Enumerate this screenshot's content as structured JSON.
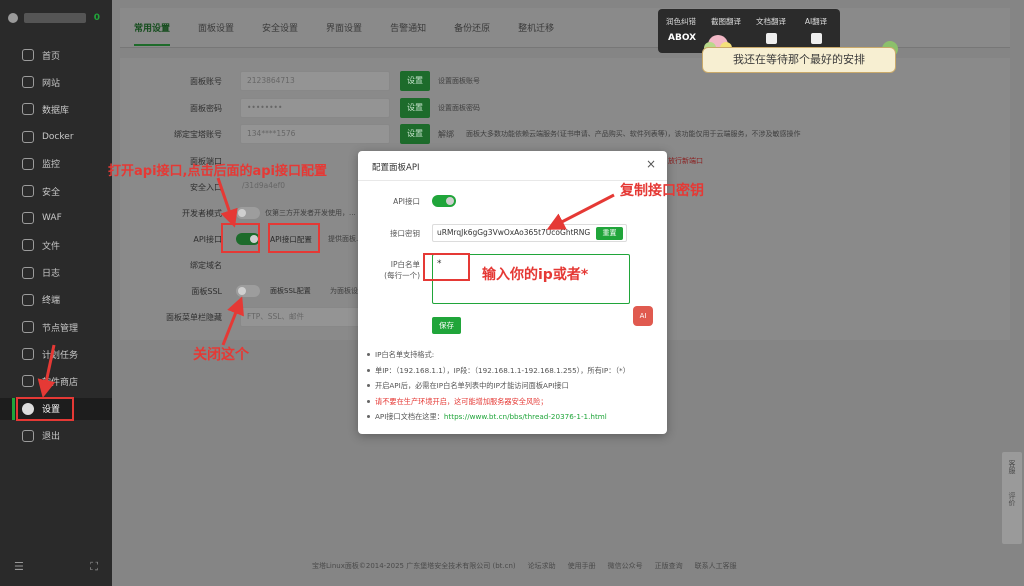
{
  "sidebar": {
    "badge": "0",
    "items": [
      {
        "label": "首页",
        "icon": "home-icon"
      },
      {
        "label": "网站",
        "icon": "globe-icon"
      },
      {
        "label": "数据库",
        "icon": "database-icon"
      },
      {
        "label": "Docker",
        "icon": "docker-icon"
      },
      {
        "label": "监控",
        "icon": "monitor-icon"
      },
      {
        "label": "安全",
        "icon": "shield-icon"
      },
      {
        "label": "WAF",
        "icon": "waf-icon"
      },
      {
        "label": "文件",
        "icon": "folder-icon"
      },
      {
        "label": "日志",
        "icon": "log-icon"
      },
      {
        "label": "终端",
        "icon": "terminal-icon"
      },
      {
        "label": "节点管理",
        "icon": "node-icon"
      },
      {
        "label": "计划任务",
        "icon": "clock-icon"
      },
      {
        "label": "软件商店",
        "icon": "store-icon"
      },
      {
        "label": "设置",
        "icon": "gear-icon",
        "active": true
      },
      {
        "label": "退出",
        "icon": "logout-icon"
      }
    ],
    "foot_left": "☰",
    "foot_right": "⛶"
  },
  "tabs": [
    "常用设置",
    "面板设置",
    "安全设置",
    "界面设置",
    "告警通知",
    "备份还原",
    "整机迁移"
  ],
  "settings": {
    "account": {
      "label": "面板账号",
      "value": "2123864713",
      "btn": "设置",
      "hint": "设置面板账号"
    },
    "password": {
      "label": "面板密码",
      "value": "••••••••",
      "btn": "设置",
      "hint": "设置面板密码"
    },
    "bind": {
      "label": "绑定宝塔账号",
      "value": "134****1576",
      "btn": "设置",
      "btn2": "解绑",
      "hint": "面板大多数功能依赖云端服务(证书申请、产品购买、软件列表等)，该功能仅用于云端服务，不涉及敏感操作"
    },
    "port": {
      "label": "面板端口"
    },
    "port_hint": "放行新端口",
    "entry": {
      "label": "安全入口",
      "value": "/31d9a4ef0"
    },
    "dev": {
      "label": "开发者模式",
      "hint": "仅第三方开发者开发使用，..."
    },
    "api": {
      "label": "API接口",
      "btn": "API接口配置",
      "hint": "提供面板..."
    },
    "domain": {
      "label": "绑定域名"
    },
    "ssl": {
      "label": "面板SSL",
      "btn": "面板SSL配置",
      "hint": "为面板设..."
    },
    "menu": {
      "label": "面板菜单栏隐藏",
      "value": "FTP、SSL、邮件"
    }
  },
  "footer": {
    "copyright": "宝塔Linux面板©2014-2025 广东堡塔安全技术有限公司 (bt.cn)",
    "links": [
      "论坛求助",
      "使用手册",
      "微信公众号",
      "正版查询",
      "联系人工客服"
    ]
  },
  "sidetools": {
    "a": "客服",
    "b": "评价"
  },
  "translate_bar": {
    "items": [
      "润色纠错",
      "截图翻译",
      "文档翻译",
      "AI翻译"
    ],
    "brand": "ABOX"
  },
  "bubble": "我还在等待那个最好的安排",
  "modal": {
    "title": "配置面板API",
    "close": "×",
    "api_label": "API接口",
    "api_enabled": true,
    "key_label": "接口密钥",
    "key_value": "uRMrqJk6gGg3VwOxAo365t7UcoGhtRNG",
    "reset": "重置",
    "whitelist_label": "IP白名单",
    "whitelist_sub": "(每行一个)",
    "whitelist_value": "*",
    "save": "保存",
    "ai": "AI",
    "notes": [
      "IP白名单支持格式:",
      "单IP：（192.168.1.1），IP段：（192.168.1.1-192.168.1.255），所有IP：（*）",
      "开启API后，必需在IP白名单列表中的IP才能访问面板API接口",
      "请不要在生产环境开启，这可能增加服务器安全风险；",
      "API接口文档在这里："
    ],
    "doc_link": "https://www.bt.cn/bbs/thread-20376-1-1.html"
  },
  "annotations": {
    "open_api": "打开api接口,点击后面的api接口配置",
    "copy_key": "复制接口密钥",
    "enter_ip": "输入你的ip或者*",
    "close_this": "关闭这个"
  }
}
